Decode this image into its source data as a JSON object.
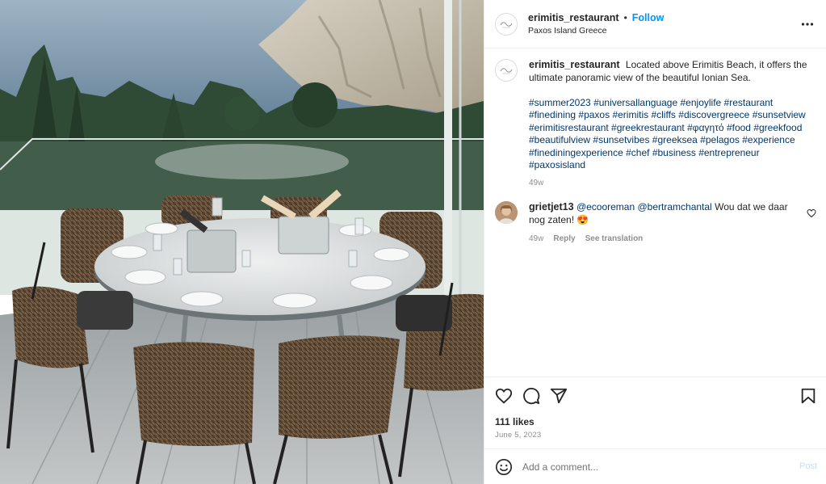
{
  "post": {
    "username": "erimitis_restaurant",
    "follow_label": "Follow",
    "location": "Paxos Island Greece"
  },
  "caption": {
    "username": "erimitis_restaurant",
    "text": "Located above Erimitis Beach, it offers the ultimate panoramic view of the beautiful Ionian Sea.",
    "hashtags": [
      "#summer2023",
      "#universallanguage",
      "#enjoylife",
      "#restaurant",
      "#finedining",
      "#paxos",
      "#erimitis",
      "#cliffs",
      "#discovergreece",
      "#sunsetview",
      "#erimitisrestaurant",
      "#greekrestaurant",
      "#φαγητό",
      "#food",
      "#greekfood",
      "#beautifulview",
      "#sunsetvibes",
      "#greeksea",
      "#pelagos",
      "#experience",
      "#finediningexperience",
      "#chef",
      "#business",
      "#entrepreneur",
      "#paxosisland"
    ],
    "age": "49w"
  },
  "comment": {
    "username": "grietjet13",
    "mention1": "@ecooreman",
    "mention2": "@bertramchantal",
    "text": "Wou dat we daar nog zaten!",
    "emoji": "😍",
    "age": "49w",
    "reply_label": "Reply",
    "translate_label": "See translation"
  },
  "actions": {
    "likes": "111 likes",
    "date": "June 5, 2023"
  },
  "add_comment": {
    "placeholder": "Add a comment...",
    "post_label": "Post"
  },
  "icons": {
    "like": "heart-icon",
    "comment": "comment-icon",
    "share": "share-icon",
    "save": "bookmark-icon",
    "more": "more-icon",
    "emoji": "emoji-icon"
  },
  "colors": {
    "accent": "#0095f6",
    "hashtag": "#00376b",
    "muted": "#8e8e8e"
  }
}
